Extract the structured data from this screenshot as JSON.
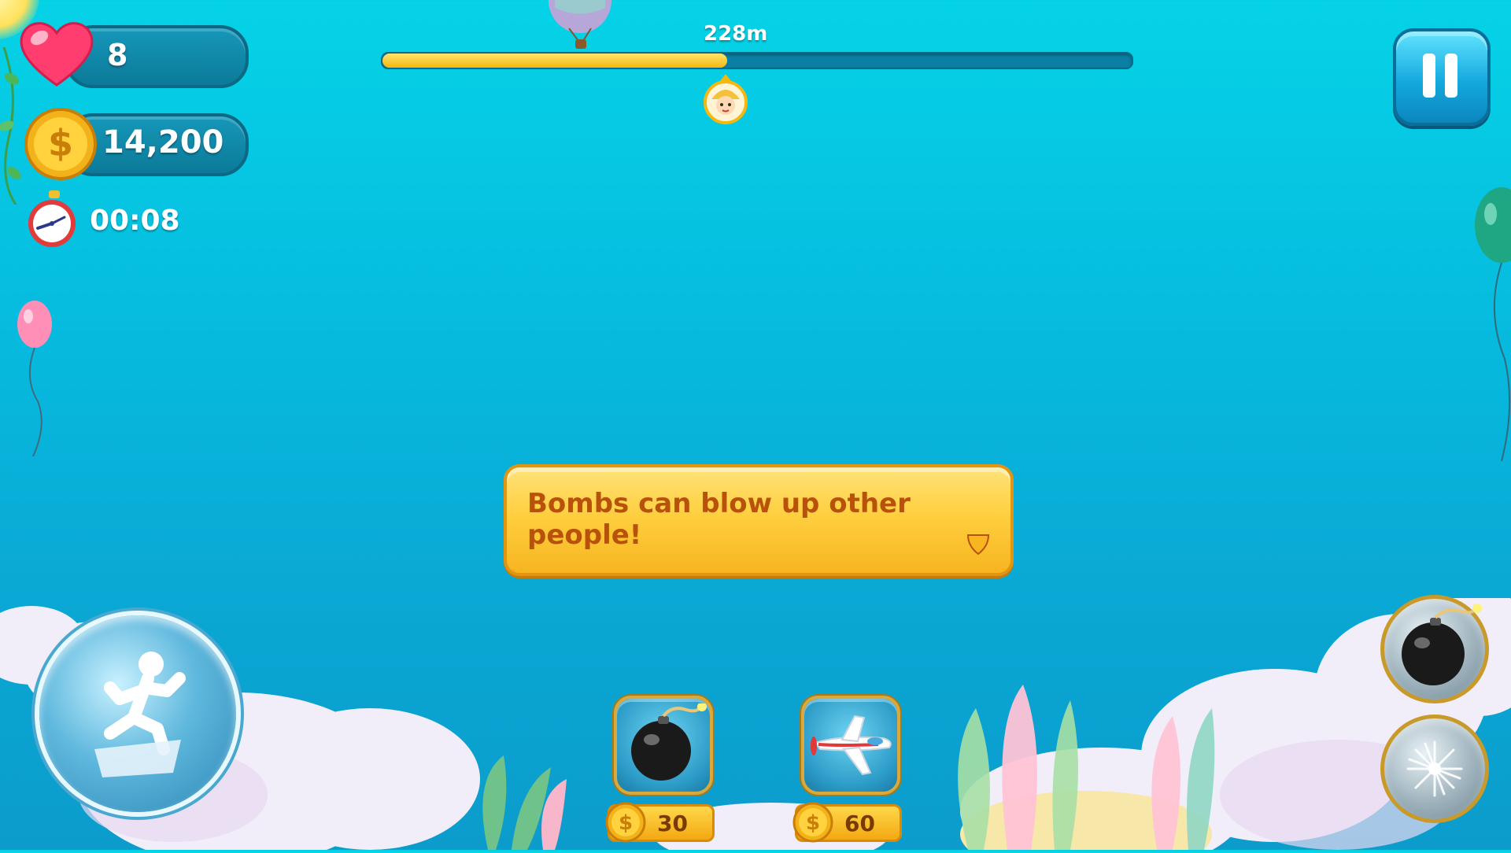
{
  "hud": {
    "lives": "8",
    "coins": "14,200",
    "timer": "00:08"
  },
  "progress": {
    "distance_label": "228m",
    "fraction": 0.46
  },
  "tooltip": {
    "text": "Bombs can blow up other people!"
  },
  "items": [
    {
      "name": "bomb",
      "price": "30"
    },
    {
      "name": "airplane",
      "price": "60"
    }
  ],
  "colors": {
    "sky_top": "#05d3e6",
    "sky_bottom": "#0b9ccc",
    "progress_fill": "#f5b80f",
    "tooltip_bg": "#ffcf3f",
    "tooltip_text": "#b8520a"
  },
  "icons": {
    "lives": "heart-icon",
    "coins": "dollar-coin-icon",
    "timer": "alarm-clock-icon",
    "pause": "pause-icon",
    "jump": "jumping-man-icon",
    "bomb": "bomb-icon",
    "airplane": "airplane-icon",
    "boost": "burst-icon"
  }
}
